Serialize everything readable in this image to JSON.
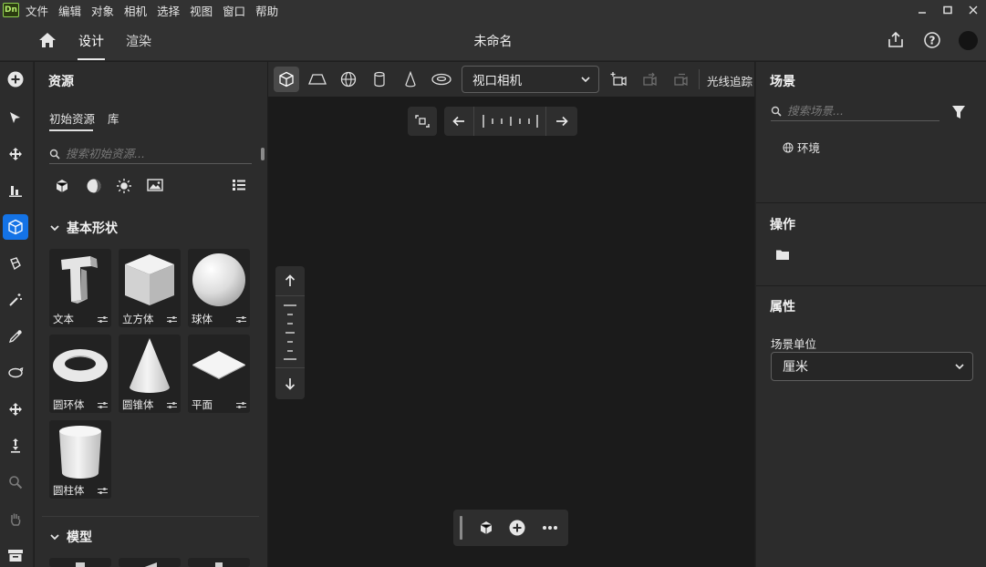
{
  "app": {
    "logo_text": "Dn"
  },
  "menu": [
    "文件",
    "编辑",
    "对象",
    "相机",
    "选择",
    "视图",
    "窗口",
    "帮助"
  ],
  "titlebar": {
    "tabs": [
      "设计",
      "渲染"
    ],
    "active_tab": "设计",
    "doc_title": "未命名"
  },
  "assets": {
    "title": "资源",
    "subtabs": [
      "初始资源",
      "库"
    ],
    "search_placeholder": "搜索初始资源...",
    "sections": {
      "basic": "基本形状",
      "models": "模型"
    },
    "shapes": [
      {
        "label": "文本",
        "icon": "text-shape-icon"
      },
      {
        "label": "立方体",
        "icon": "cube-shape-icon"
      },
      {
        "label": "球体",
        "icon": "sphere-shape-icon"
      },
      {
        "label": "圆环体",
        "icon": "torus-shape-icon"
      },
      {
        "label": "圆锥体",
        "icon": "cone-shape-icon"
      },
      {
        "label": "平面",
        "icon": "plane-shape-icon"
      },
      {
        "label": "圆柱体",
        "icon": "cylinder-shape-icon"
      }
    ]
  },
  "viewport": {
    "camera_select": "视口相机",
    "raytrace_label": "光线追踪"
  },
  "scene": {
    "title": "场景",
    "search_placeholder": "搜索场景...",
    "items": [
      "环境"
    ]
  },
  "actions": {
    "title": "操作"
  },
  "properties": {
    "title": "属性",
    "unit_label": "场景单位",
    "unit_value": "厘米"
  },
  "colors": {
    "accent": "#1473e6",
    "panel": "#2c2c2c",
    "viewport": "#1b1b1b"
  }
}
